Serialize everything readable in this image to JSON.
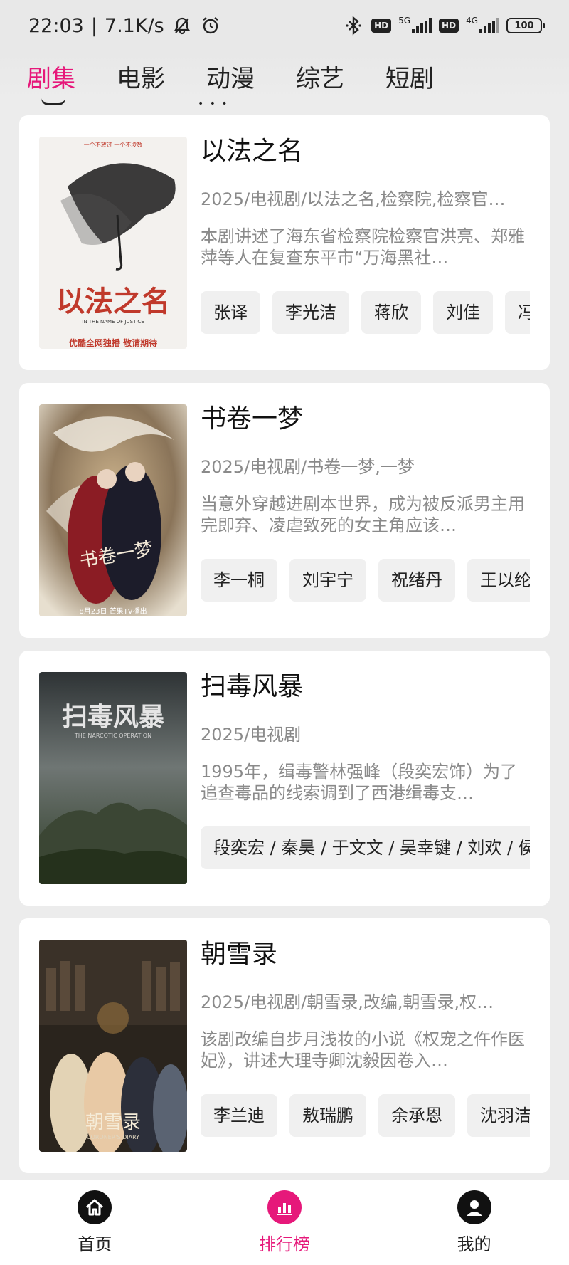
{
  "status_bar": {
    "time": "22:03",
    "separator": "|",
    "speed": "7.1K/s",
    "net1": "5G",
    "net2": "4G",
    "hd": "HD",
    "battery": "100"
  },
  "tabs": [
    {
      "label": "剧集",
      "active": true
    },
    {
      "label": "电影",
      "active": false
    },
    {
      "label": "动漫",
      "active": false
    },
    {
      "label": "综艺",
      "active": false
    },
    {
      "label": "短剧",
      "active": false
    }
  ],
  "cards": [
    {
      "title": "以法之名",
      "meta": "2025/电视剧/以法之名,检察院,检察官…",
      "desc": "本剧讲述了海东省检察院检察官洪亮、郑雅萍等人在复查东平市“万海黑社…",
      "cast": [
        "张译",
        "李光洁",
        "蒋欣",
        "刘佳",
        "冯"
      ],
      "poster_text": "以法之名",
      "poster_sub": "IN THE NAME OF JUSTICE",
      "poster_top": "一个不放过    一个不凌数",
      "poster_bottom": "优酷全网独播  敬请期待"
    },
    {
      "title": "书卷一梦",
      "meta": "2025/电视剧/书卷一梦,一梦",
      "desc": "当意外穿越进剧本世界，成为被反派男主用完即弃、凌虐致死的女主角应该…",
      "cast": [
        "李一桐",
        "刘宇宁",
        "祝绪丹",
        "王以纶"
      ],
      "poster_text": "书卷一梦",
      "poster_bottom": "8月23日 芒果TV播出"
    },
    {
      "title": "扫毒风暴",
      "meta": "2025/电视剧",
      "desc": "1995年，缉毒警林强峰（段奕宏饰）为了追查毒品的线索调到了西港缉毒支…",
      "cast_line": "段奕宏 / 秦昊 / 于文文 / 吴幸键 / 刘欢 / 侯",
      "poster_text": "扫毒风暴",
      "poster_sub": "THE NARCOTIC OPERATION"
    },
    {
      "title": "朝雪录",
      "meta": "2025/电视剧/朝雪录,改编,朝雪录,权…",
      "desc": "该剧改编自步月浅妆的小说《权宠之仵作医妃》，讲述大理寺卿沈毅因卷入…",
      "cast": [
        "李兰迪",
        "敖瑞鹏",
        "余承恩",
        "沈羽洁"
      ],
      "poster_text": "朝雪录",
      "poster_sub": "CORONER'S DIARY"
    }
  ],
  "bottom_nav": [
    {
      "label": "首页",
      "icon": "home-icon",
      "active": false
    },
    {
      "label": "排行榜",
      "icon": "bar-chart-icon",
      "active": true
    },
    {
      "label": "我的",
      "icon": "user-icon",
      "active": false
    }
  ],
  "colors": {
    "accent": "#e6187a",
    "background": "#ececec",
    "card": "#ffffff",
    "muted_text": "#8a8a8a",
    "chip_bg": "#f0f0f0"
  }
}
